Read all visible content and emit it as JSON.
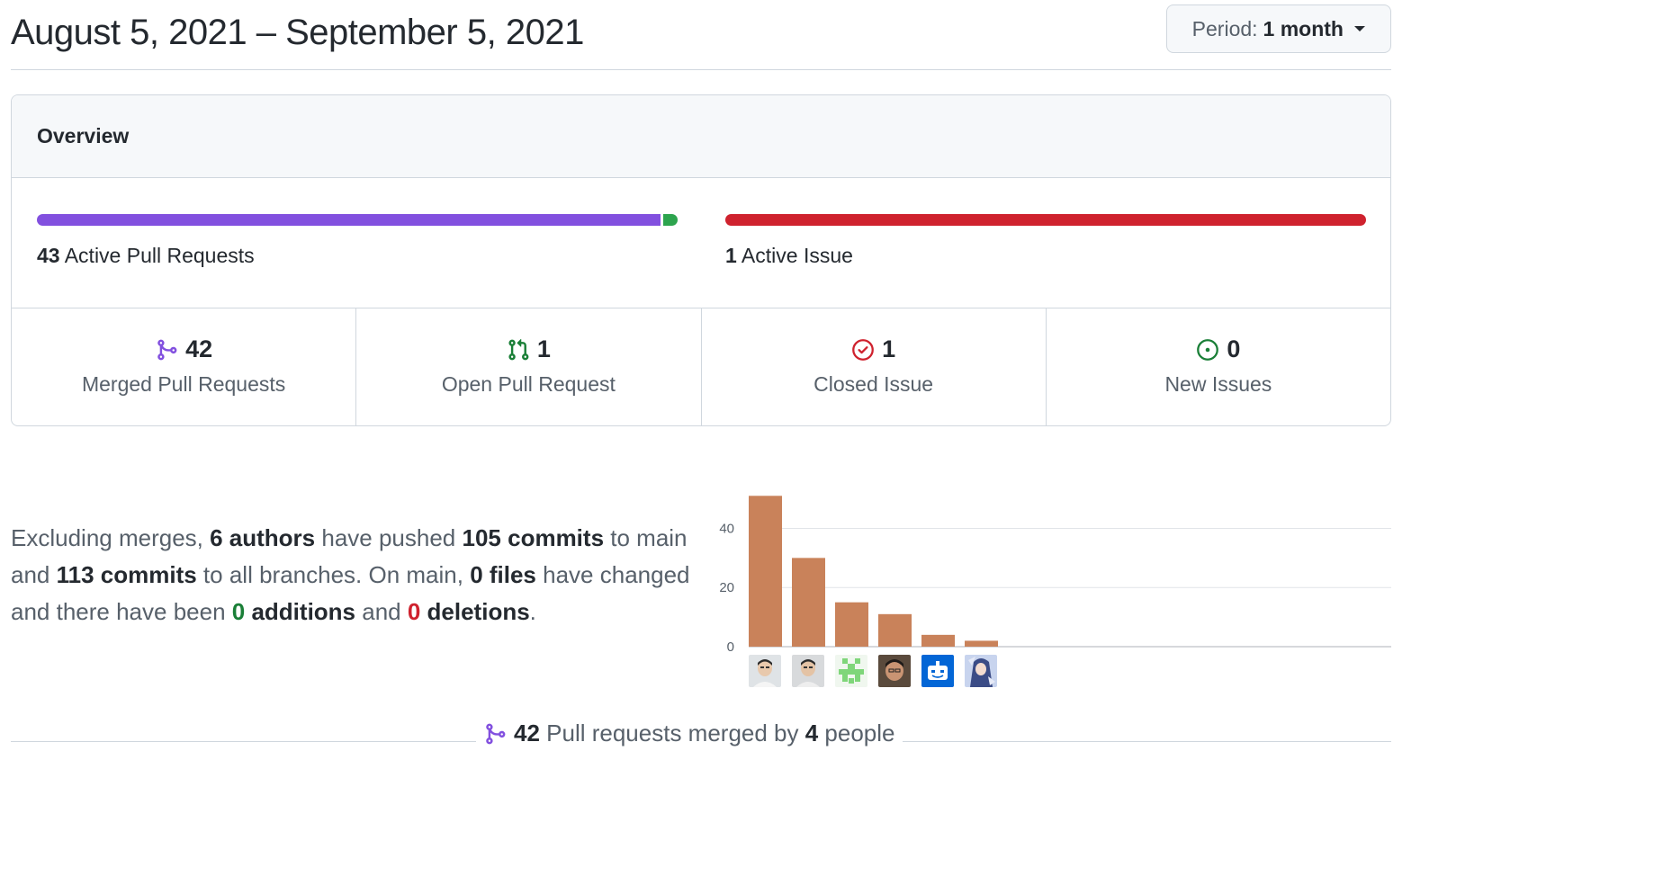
{
  "header": {
    "date_range": "August 5, 2021 – September 5, 2021",
    "period_label": "Period:",
    "period_value": "1 month"
  },
  "overview": {
    "title": "Overview",
    "pull_requests": {
      "count": "43",
      "label": "Active Pull Requests",
      "merged_fraction": 0.977,
      "colors": {
        "merged": "#8250df",
        "open": "#2da44e"
      }
    },
    "issues": {
      "count": "1",
      "label": "Active Issue",
      "closed_fraction": 1.0,
      "colors": {
        "closed": "#cf222e"
      }
    },
    "stats": [
      {
        "icon": "git-merge-icon",
        "value": "42",
        "label": "Merged Pull Requests",
        "color": "#8250df"
      },
      {
        "icon": "git-pull-request-icon",
        "value": "1",
        "label": "Open Pull Request",
        "color": "#1a7f37"
      },
      {
        "icon": "issue-closed-icon",
        "value": "1",
        "label": "Closed Issue",
        "color": "#cf222e"
      },
      {
        "icon": "issue-opened-icon",
        "value": "0",
        "label": "New Issues",
        "color": "#1a7f37"
      }
    ]
  },
  "summary": {
    "p1": "Excluding merges, ",
    "authors": "6 authors",
    "p2": " have pushed ",
    "commits_main": "105 commits",
    "p3": " to main and ",
    "commits_all": "113 commits",
    "p4": " to all branches. On main, ",
    "files": "0 files",
    "p5": " have changed and there have been ",
    "additions_num": "0",
    "additions_word": " additions",
    "p6": " and ",
    "deletions_num": "0",
    "deletions_word": " deletions",
    "p7": "."
  },
  "chart_data": {
    "type": "bar",
    "categories": [
      "author-1",
      "author-2",
      "author-3",
      "author-4",
      "author-5",
      "author-6"
    ],
    "values": [
      51,
      30,
      15,
      11,
      4,
      2
    ],
    "ylim": [
      0,
      52
    ],
    "yticks": [
      "0",
      "20",
      "40"
    ],
    "bar_color": "#c9825a",
    "grid": true
  },
  "footer": {
    "count": "42",
    "text1": " Pull requests merged by ",
    "people": "4",
    "text2": " people"
  }
}
